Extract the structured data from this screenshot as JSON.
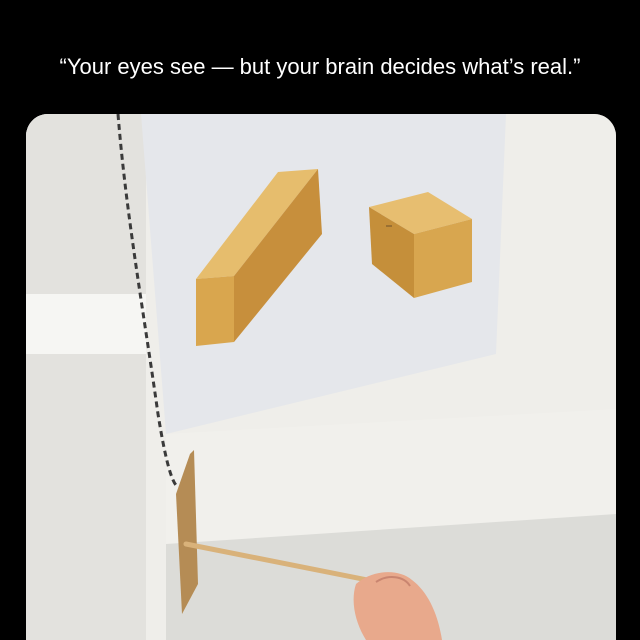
{
  "caption": {
    "text": "“Your eyes see — but your brain decides what’s real.”"
  },
  "photo": {
    "subject": "anamorphic box illusion with cardboard board on string and wooden stick held by hand",
    "colors": {
      "wall": "#ecebe7",
      "poster": "#e7e9ed",
      "box_top": "#e2b766",
      "box_front": "#d9a64e",
      "box_side": "#c58f3a",
      "cardboard": "#b58c55",
      "stick": "#d9b27a",
      "skin": "#e8a98c"
    }
  }
}
